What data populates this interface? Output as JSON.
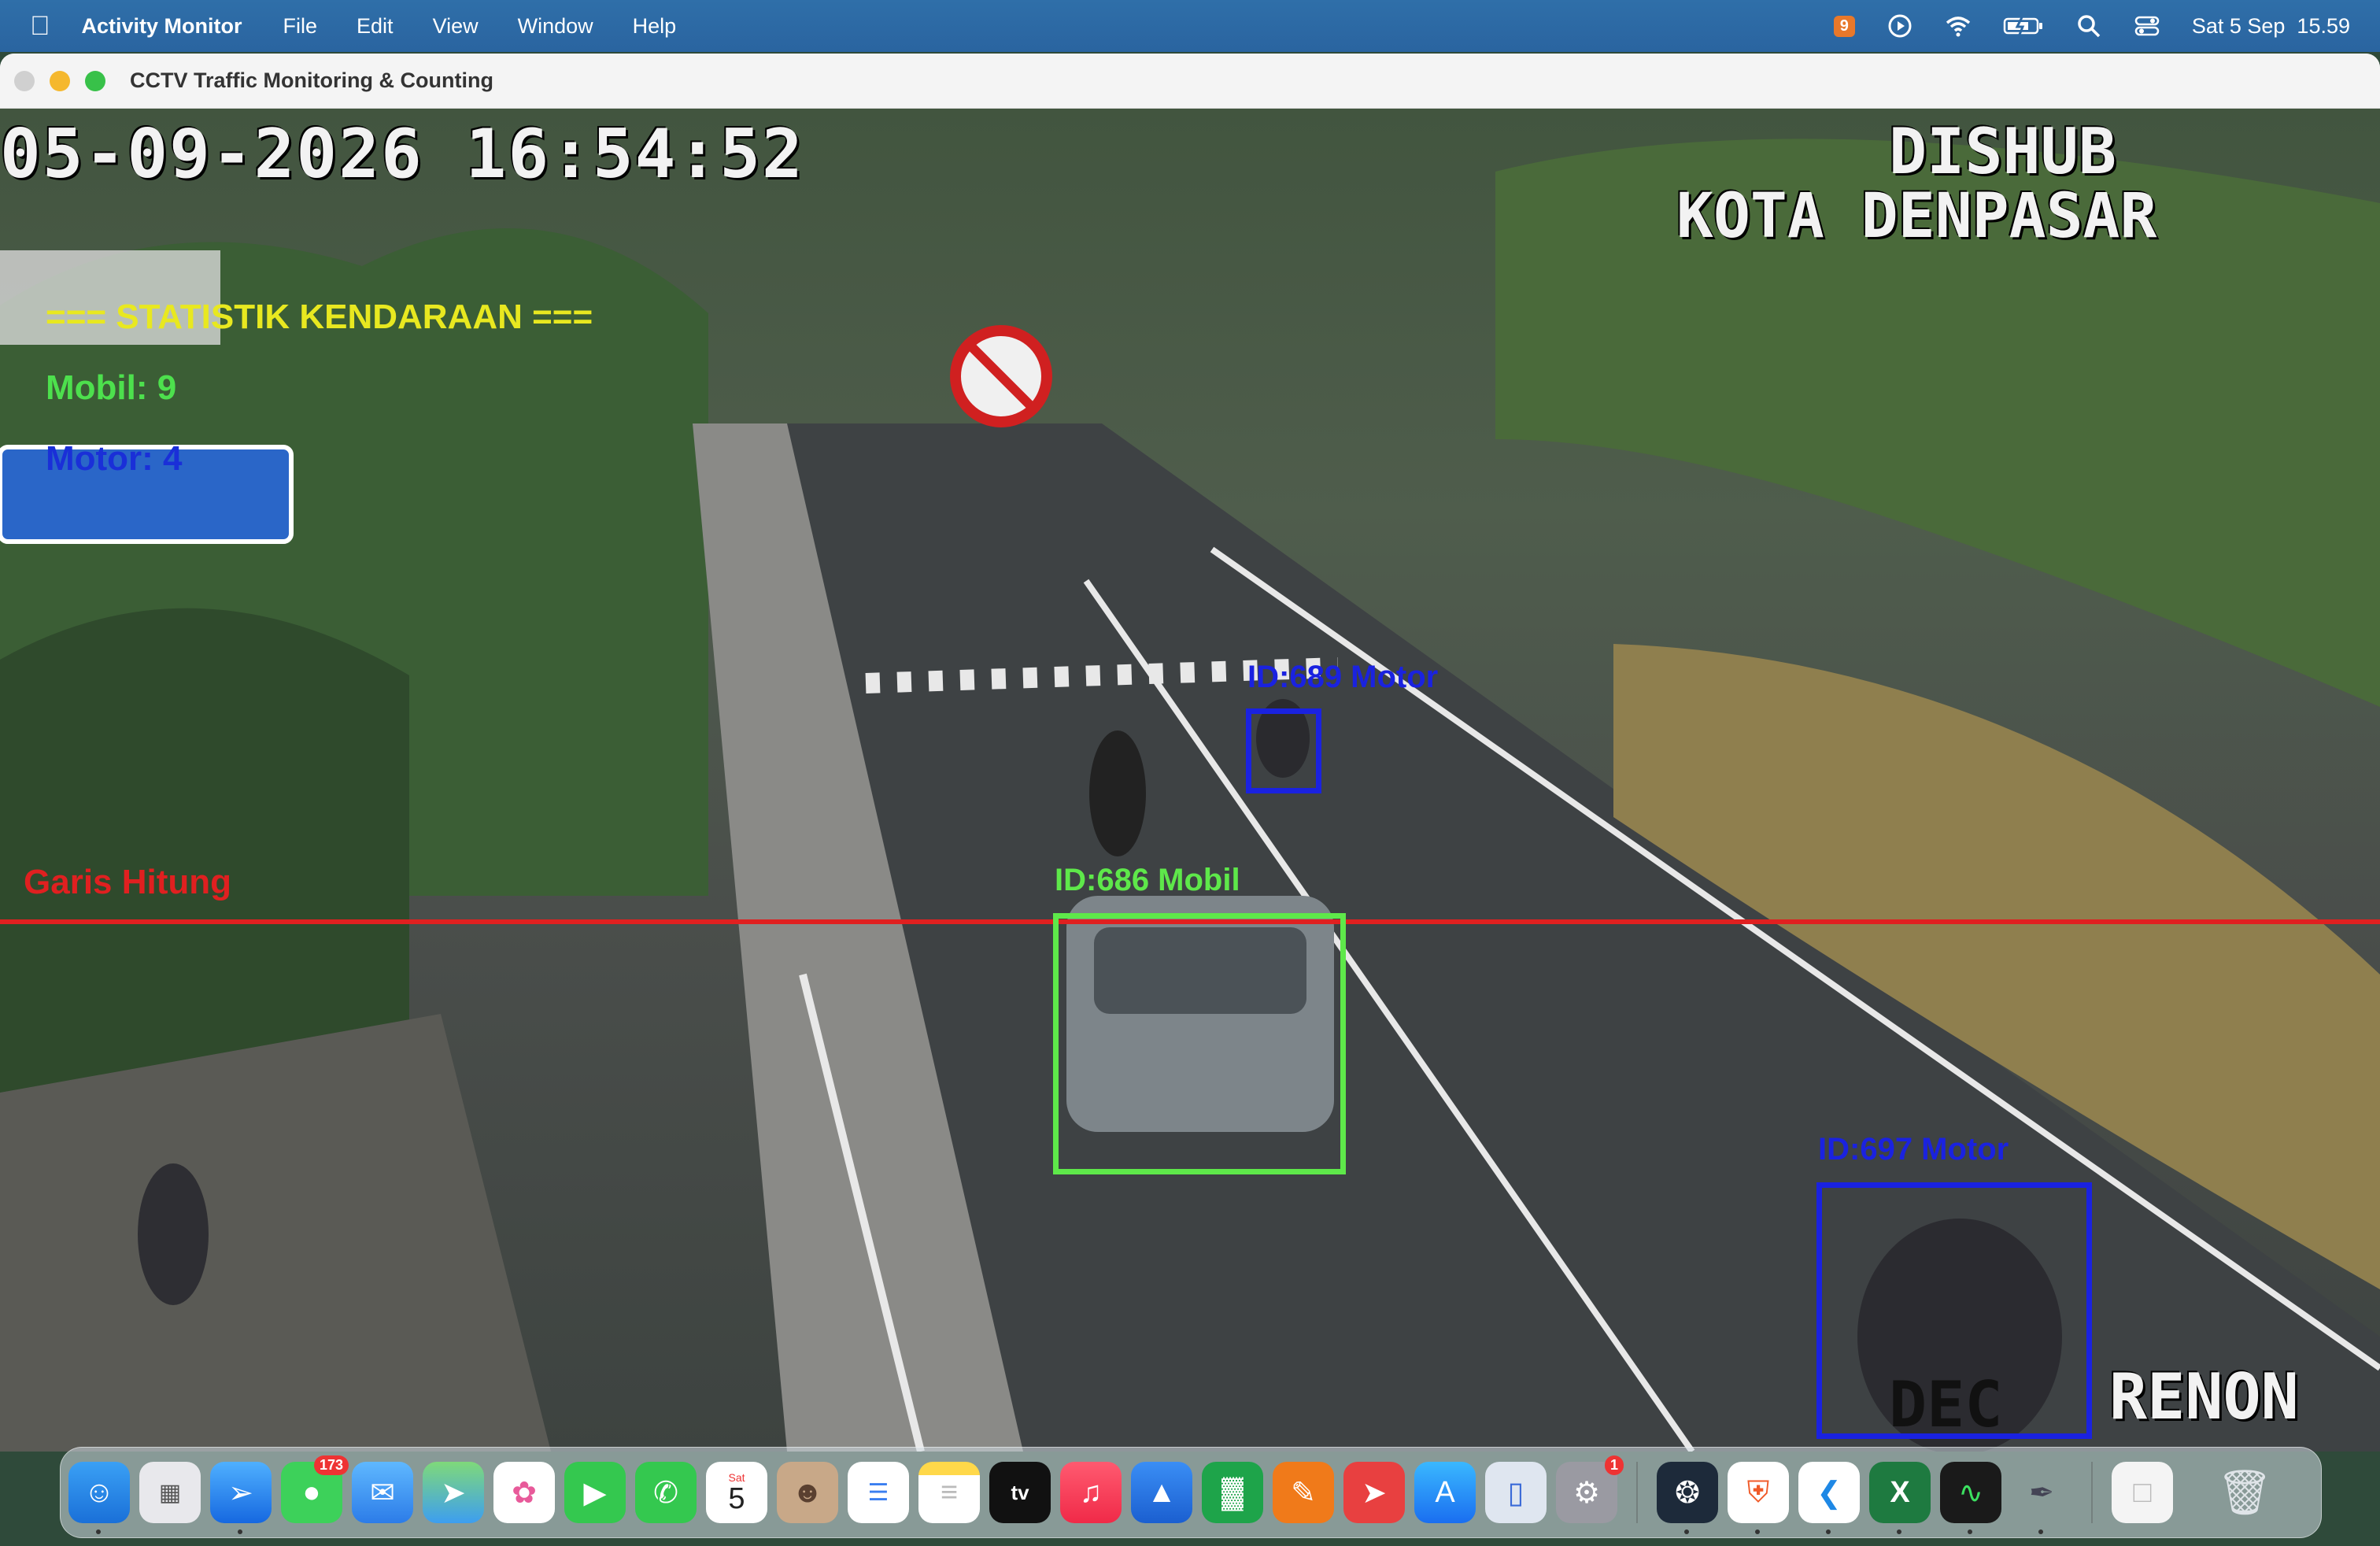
{
  "menubar": {
    "app_name": "Activity Monitor",
    "menus": [
      "File",
      "Edit",
      "View",
      "Window",
      "Help"
    ],
    "notification_badge": "9",
    "datetime": "Sat 5 Sep  15.59"
  },
  "window": {
    "title": "CCTV Traffic Monitoring & Counting"
  },
  "feed": {
    "timestamp": "05-09-2026 16:54:52",
    "watermark_line1": "DISHUB",
    "watermark_line2": "KOTA DENPASAR",
    "location": "RENON",
    "dec": "DEC",
    "stats": {
      "title": "=== STATISTIK KENDARAAN ===",
      "mobil": "Mobil: 9",
      "motor": "Motor: 4"
    },
    "counting_line_label": "Garis Hitung",
    "detections": [
      {
        "label": "ID:689 Motor",
        "color": "#1a22e0"
      },
      {
        "label": "ID:686 Mobil",
        "color": "#5ee84a"
      },
      {
        "label": "ID:697 Motor",
        "color": "#1a22e0"
      }
    ]
  },
  "dock": {
    "messages_badge": "173",
    "calendar_day": "Sat",
    "calendar_date": "5",
    "settings_badge": "1",
    "items": [
      "finder-icon",
      "launchpad-icon",
      "safari-icon",
      "messages-icon",
      "mail-icon",
      "maps-icon",
      "photos-icon",
      "facetime-icon",
      "phone-icon",
      "calendar-icon",
      "contacts-icon",
      "reminders-icon",
      "notes-icon",
      "tv-icon",
      "music-icon",
      "keynote-icon",
      "numbers-icon",
      "pages-icon",
      "rocket-icon",
      "app-store-icon",
      "iphone-mirroring-icon",
      "system-settings-icon",
      "chatgpt-icon",
      "brave-icon",
      "vscode-icon",
      "excel-icon",
      "activity-monitor-icon",
      "pen-icon",
      "document-icon",
      "trash-icon"
    ]
  },
  "colors": {
    "menubar": "#2c68a3",
    "mobil_box": "#5ee84a",
    "motor_box": "#1a22e0",
    "count_line": "#e02020",
    "stat_title": "#e8e820"
  }
}
